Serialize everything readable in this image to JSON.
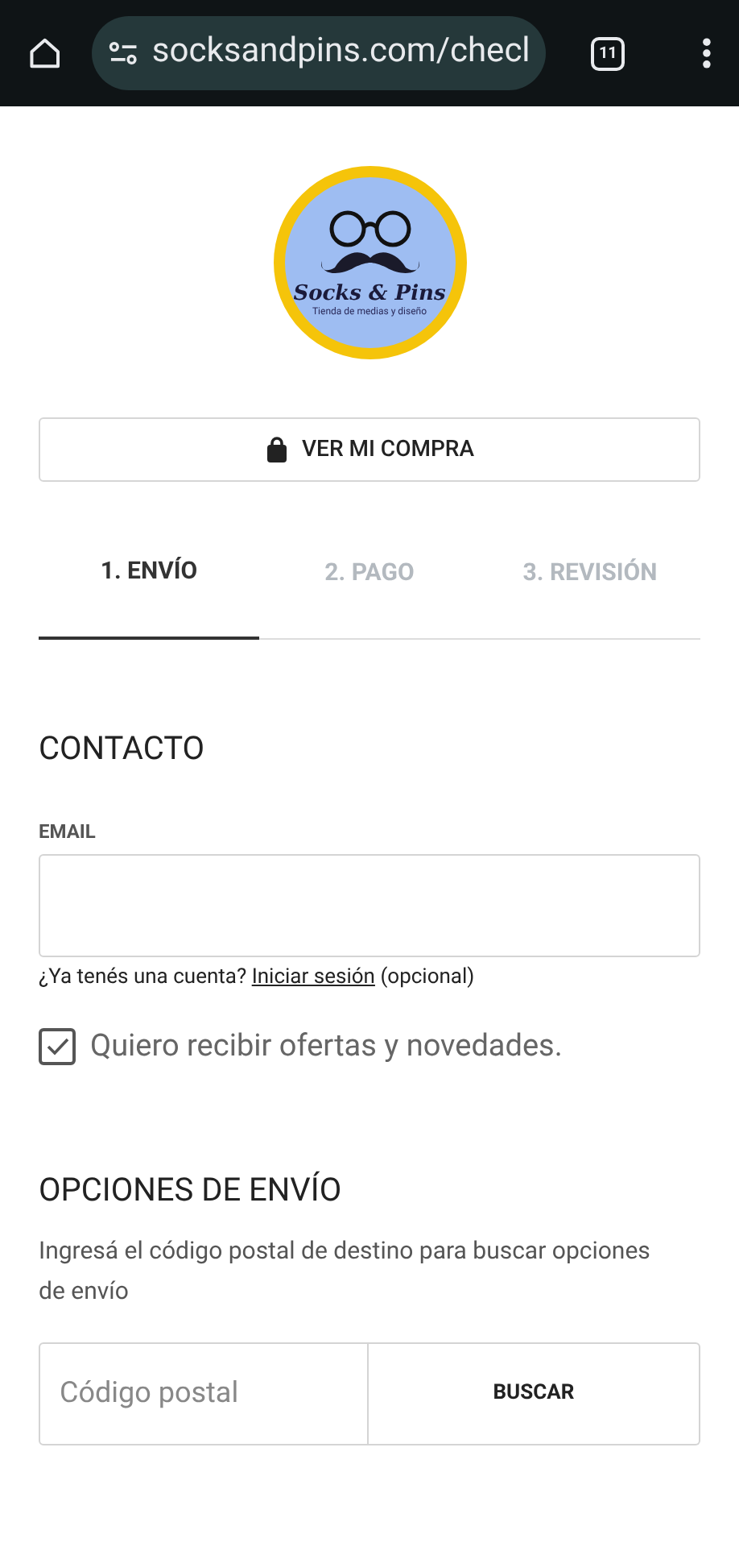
{
  "browser": {
    "url": "socksandpins.com/checl",
    "tab_count": "11"
  },
  "logo": {
    "name": "Socks & Pins",
    "tagline": "Tienda de medias y diseño"
  },
  "cart_button": {
    "label": "VER MI COMPRA"
  },
  "steps": [
    {
      "label": "1. ENVÍO",
      "selected": true
    },
    {
      "label": "2. PAGO",
      "selected": false
    },
    {
      "label": "3. REVISIÓN",
      "selected": false
    }
  ],
  "contact": {
    "title": "CONTACTO",
    "email_label": "EMAIL",
    "account_prompt": "¿Ya tenés una cuenta?",
    "login_link": "Iniciar sesión",
    "optional": "(opcional)",
    "newsletter": {
      "label": "Quiero recibir ofertas y novedades.",
      "checked": true
    }
  },
  "shipping": {
    "title": "OPCIONES DE ENVÍO",
    "description": "Ingresá el código postal de destino para buscar opciones de envío",
    "postal_code": {
      "placeholder": "Código postal"
    },
    "search_button": "BUSCAR"
  }
}
